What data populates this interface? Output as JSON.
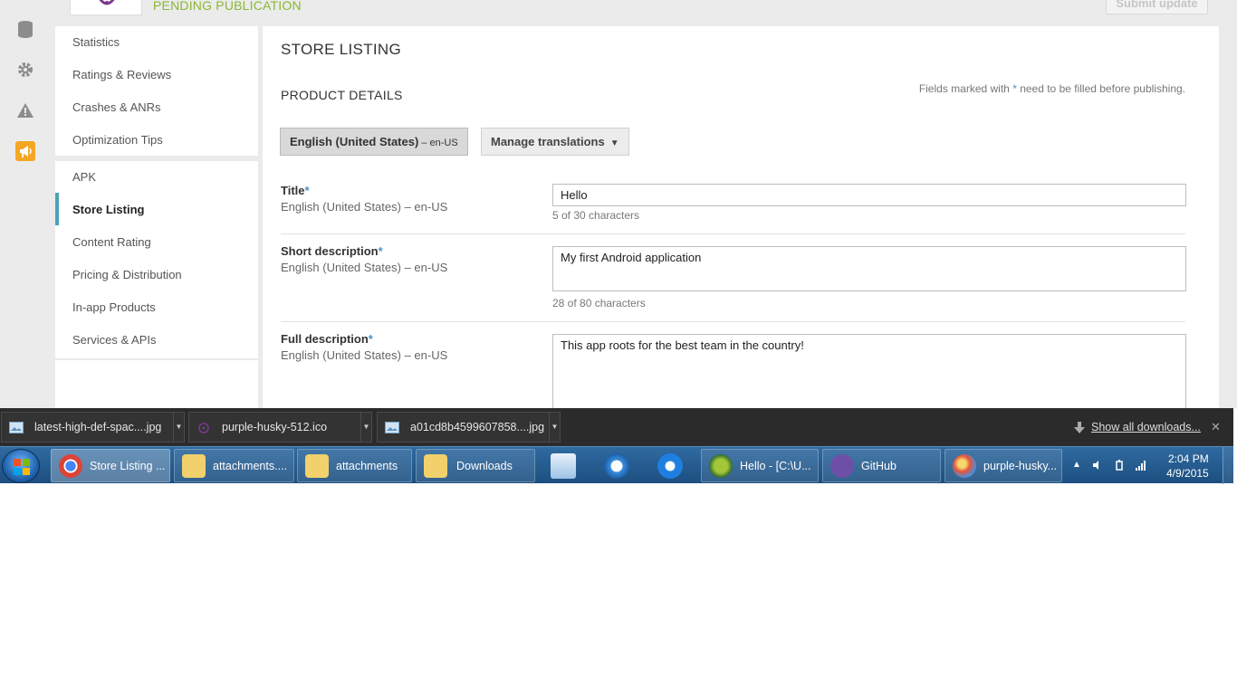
{
  "header": {
    "status": "PENDING PUBLICATION",
    "submit_label": "Submit update"
  },
  "rail": {
    "icons": [
      "database-icon",
      "gear-icon",
      "warning-icon",
      "megaphone-icon"
    ],
    "accent": "#f5a623"
  },
  "nav": {
    "group1": [
      "Statistics",
      "Ratings & Reviews",
      "Crashes & ANRs",
      "Optimization Tips"
    ],
    "group2": [
      "APK",
      "Store Listing",
      "Content Rating",
      "Pricing & Distribution",
      "In-app Products",
      "Services & APIs"
    ],
    "active": "Store Listing"
  },
  "main": {
    "page_title": "STORE LISTING",
    "section_title": "PRODUCT DETAILS",
    "fields_note_pre": "Fields marked with ",
    "fields_note_star": "*",
    "fields_note_post": " need to be filled before publishing.",
    "lang_button_main": "English (United States)",
    "lang_button_code": " – en-US",
    "translations_label": "Manage translations",
    "fields": [
      {
        "label": "Title",
        "star": "*",
        "lang": "English (United States) – en-US",
        "value": "Hello",
        "count": "5 of 30 characters"
      },
      {
        "label": "Short description",
        "star": "*",
        "lang": "English (United States) – en-US",
        "value": "My first Android application",
        "count": "28 of 80 characters"
      },
      {
        "label": "Full description",
        "star": "*",
        "lang": "English (United States) – en-US",
        "value": "This app roots for the best team in the country!"
      }
    ]
  },
  "downloads": {
    "items": [
      "latest-high-def-spac....jpg",
      "purple-husky-512.ico",
      "a01cd8b4599607858....jpg"
    ],
    "show_all": "Show all downloads...",
    "close": "✕"
  },
  "taskbar": {
    "items": [
      {
        "label": "Store Listing ..."
      },
      {
        "label": "attachments...."
      },
      {
        "label": "attachments"
      },
      {
        "label": "Downloads"
      },
      {
        "label": "Hello - [C:\\U..."
      },
      {
        "label": "GitHub"
      },
      {
        "label": "purple-husky..."
      }
    ],
    "time": "2:04 PM",
    "date": "4/9/2015"
  }
}
